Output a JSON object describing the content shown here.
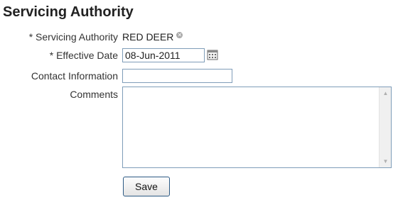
{
  "page": {
    "title": "Servicing Authority"
  },
  "form": {
    "servicing_authority": {
      "label": "* Servicing Authority",
      "value": "RED DEER",
      "clear_icon": "clear-icon"
    },
    "effective_date": {
      "label": "* Effective Date",
      "value": "08-Jun-2011",
      "icon": "calendar-icon"
    },
    "contact_information": {
      "label": "Contact Information",
      "value": ""
    },
    "comments": {
      "label": "Comments",
      "value": ""
    }
  },
  "actions": {
    "save_label": "Save"
  },
  "colors": {
    "input_border": "#7f9db9",
    "button_border": "#2c5a84",
    "text": "#222222"
  }
}
